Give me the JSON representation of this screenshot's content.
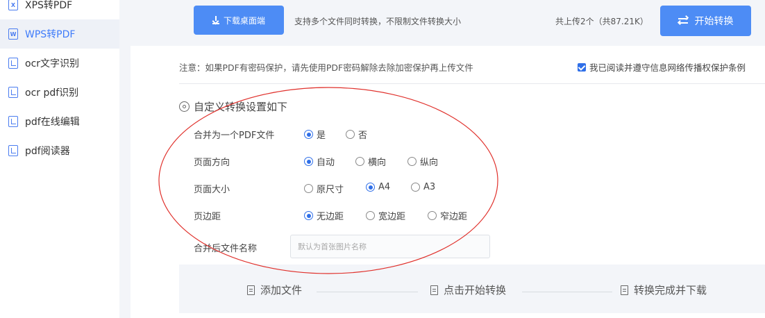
{
  "sidebar": {
    "items": [
      {
        "label": "XPS转PDF",
        "icon": "xps-file-icon",
        "icon_glyph": "X",
        "active": false
      },
      {
        "label": "WPS转PDF",
        "icon": "wps-file-icon",
        "icon_glyph": "W",
        "active": true
      },
      {
        "label": "ocr文字识别",
        "icon": "document-icon",
        "icon_glyph": "",
        "active": false
      },
      {
        "label": "ocr pdf识别",
        "icon": "document-icon",
        "icon_glyph": "",
        "active": false
      },
      {
        "label": "pdf在线编辑",
        "icon": "document-icon",
        "icon_glyph": "",
        "active": false
      },
      {
        "label": "pdf阅读器",
        "icon": "document-icon",
        "icon_glyph": "",
        "active": false
      }
    ]
  },
  "topbar": {
    "download_label": "下载桌面端",
    "tip": "支持多个文件同时转换，不限制文件转换大小",
    "upload_count": "共上传2个（共87.21K）",
    "start_label": "开始转换"
  },
  "notice": {
    "text": "注意：如果PDF有密码保护，请先使用PDF密码解除去除加密保护再上传文件",
    "agree_label": "我已阅读并遵守信息网络传播权保护条例",
    "agree_checked": true
  },
  "settings": {
    "title": "自定义转换设置如下",
    "rows": [
      {
        "label": "合并为一个PDF文件",
        "options": [
          "是",
          "否"
        ],
        "selected": "是"
      },
      {
        "label": "页面方向",
        "options": [
          "自动",
          "横向",
          "纵向"
        ],
        "selected": "自动"
      },
      {
        "label": "页面大小",
        "options": [
          "原尺寸",
          "A4",
          "A3"
        ],
        "selected": "A4"
      },
      {
        "label": "页边距",
        "options": [
          "无边距",
          "宽边距",
          "窄边距"
        ],
        "selected": "无边距"
      }
    ],
    "filename_label": "合并后文件名称",
    "filename_placeholder": "默认为首张图片名称",
    "filename_value": ""
  },
  "steps": [
    {
      "label": "添加文件"
    },
    {
      "label": "点击开始转换"
    },
    {
      "label": "转换完成并下载"
    }
  ],
  "colors": {
    "accent": "#4d8cf5",
    "selected": "#2f6fe8",
    "annotation": "#e0302b"
  }
}
